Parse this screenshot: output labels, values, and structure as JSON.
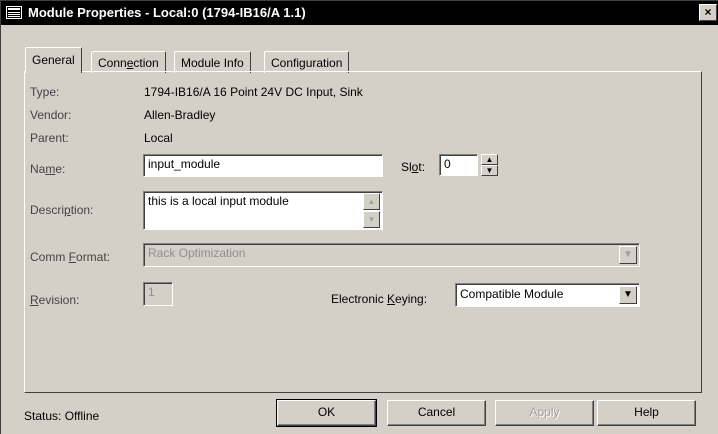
{
  "window": {
    "title": "Module Properties - Local:0 (1794-IB16/A 1.1)",
    "close_glyph": "×"
  },
  "tabs": [
    {
      "label_pre": "General",
      "label_u": "",
      "label_post": "",
      "active": true
    },
    {
      "label_pre": "Conn",
      "label_u": "e",
      "label_post": "ction",
      "active": false
    },
    {
      "label_pre": "Module Info",
      "label_u": "",
      "label_post": "",
      "active": false
    },
    {
      "label_pre": "Configuration",
      "label_u": "",
      "label_post": "",
      "active": false
    }
  ],
  "general": {
    "type_label": "Type:",
    "type_value": "1794-IB16/A 16 Point 24V DC Input, Sink",
    "vendor_label": "Vendor:",
    "vendor_value": "Allen-Bradley",
    "parent_label": "Parent:",
    "parent_value": "Local",
    "name_label_pre": "Na",
    "name_label_u": "m",
    "name_label_post": "e:",
    "name_value": "input_module",
    "slot_label_pre": "Sl",
    "slot_label_u": "o",
    "slot_label_post": "t:",
    "slot_value": "0",
    "description_label_pre": "Descri",
    "description_label_u": "p",
    "description_label_post": "tion:",
    "description_value": "this is a local input module",
    "comm_format_label_pre": "Comm ",
    "comm_format_label_u": "F",
    "comm_format_label_post": "ormat:",
    "comm_format_value": "Rack Optimization",
    "revision_label_u": "R",
    "revision_label_post": "evision:",
    "revision_value": "1",
    "keying_label_pre": "Electronic ",
    "keying_label_u": "K",
    "keying_label_post": "eying:",
    "keying_value": "Compatible Module"
  },
  "footer": {
    "status_label": "Status:",
    "status_value": "Offline",
    "ok_label": "OK",
    "cancel_label": "Cancel",
    "apply_label": "Apply",
    "help_label": "Help"
  },
  "icons": {
    "up_glyph": "▲",
    "down_glyph": "▼"
  }
}
